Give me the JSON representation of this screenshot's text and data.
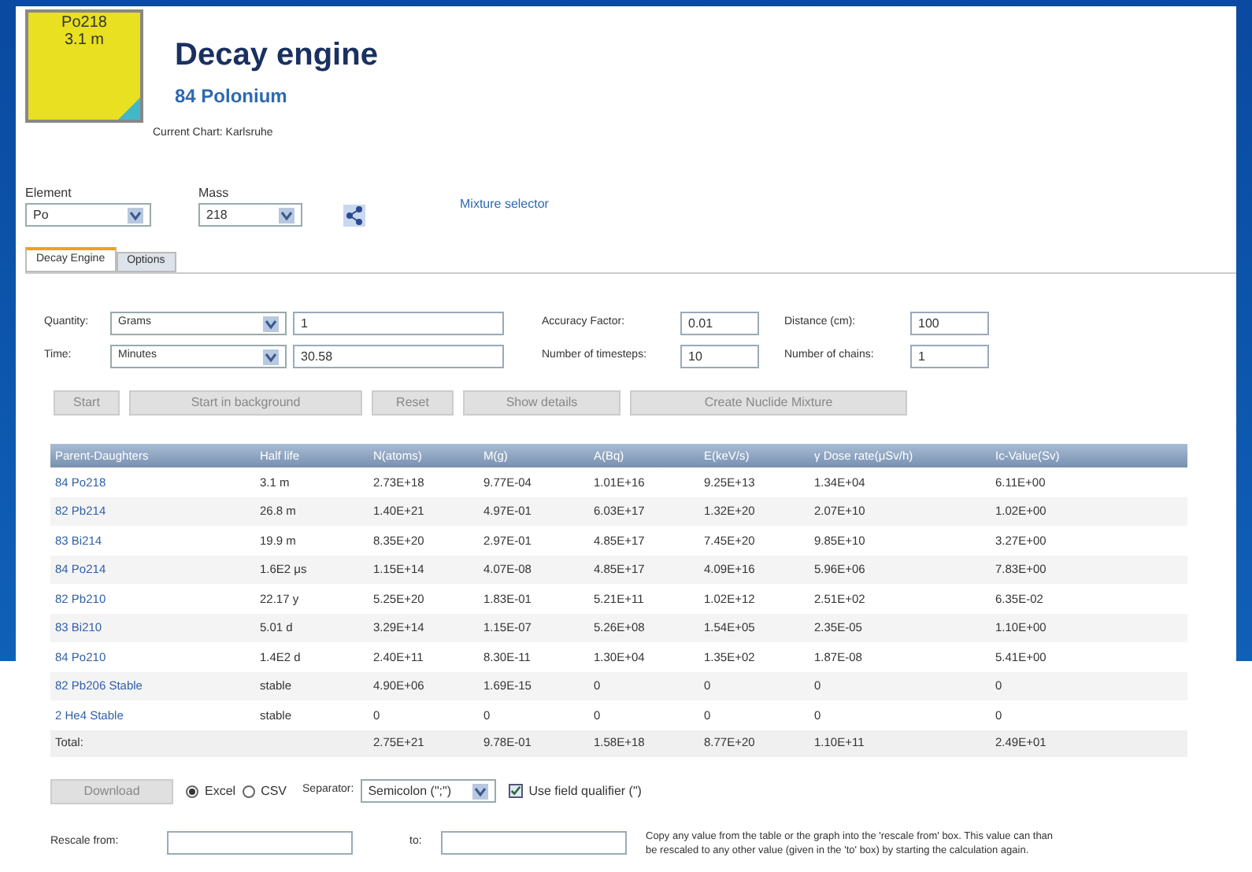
{
  "nuclide_tile": {
    "symbol": "Po218",
    "half_life": "3.1 m"
  },
  "title": "Decay engine",
  "subtitle": "84 Polonium",
  "current_chart": "Current Chart: Karlsruhe",
  "element": {
    "label": "Element",
    "value": "Po"
  },
  "mass": {
    "label": "Mass",
    "value": "218"
  },
  "mixture_link": "Mixture selector",
  "tabs": [
    {
      "label": "Decay Engine",
      "selected": true
    },
    {
      "label": "Options",
      "selected": false
    }
  ],
  "quantity": {
    "label": "Quantity:",
    "unit": "Grams",
    "value": "1"
  },
  "time": {
    "label": "Time:",
    "unit": "Minutes",
    "value": "30.58"
  },
  "params": [
    {
      "label": "Accuracy Factor:",
      "value": "0.01"
    },
    {
      "label": "Distance (cm):",
      "value": "100"
    },
    {
      "label": "Number of timesteps:",
      "value": "10"
    },
    {
      "label": "Number of chains:",
      "value": "1"
    }
  ],
  "actions": [
    "Start",
    "Start in background",
    "Reset",
    "Show details",
    "Create Nuclide Mixture"
  ],
  "table": {
    "columns": [
      "Parent-Daughters",
      "Half life",
      "N(atoms)",
      "M(g)",
      "A(Bq)",
      "E(keV/s)",
      "γ Dose rate(μSv/h)",
      "Ic-Value(Sv)"
    ],
    "rows": [
      [
        "84 Po218",
        "3.1 m",
        "2.73E+18",
        "9.77E-04",
        "1.01E+16",
        "9.25E+13",
        "1.34E+04",
        "6.11E+00"
      ],
      [
        "82 Pb214",
        "26.8 m",
        "1.40E+21",
        "4.97E-01",
        "6.03E+17",
        "1.32E+20",
        "2.07E+10",
        "1.02E+00"
      ],
      [
        "83 Bi214",
        "19.9 m",
        "8.35E+20",
        "2.97E-01",
        "4.85E+17",
        "7.45E+20",
        "9.85E+10",
        "3.27E+00"
      ],
      [
        "84 Po214",
        "1.6E2 μs",
        "1.15E+14",
        "4.07E-08",
        "4.85E+17",
        "4.09E+16",
        "5.96E+06",
        "7.83E+00"
      ],
      [
        "82 Pb210",
        "22.17 y",
        "5.25E+20",
        "1.83E-01",
        "5.21E+11",
        "1.02E+12",
        "2.51E+02",
        "6.35E-02"
      ],
      [
        "83 Bi210",
        "5.01 d",
        "3.29E+14",
        "1.15E-07",
        "5.26E+08",
        "1.54E+05",
        "2.35E-05",
        "1.10E+00"
      ],
      [
        "84 Po210",
        "1.4E2 d",
        "2.40E+11",
        "8.30E-11",
        "1.30E+04",
        "1.35E+02",
        "1.87E-08",
        "5.41E+00"
      ],
      [
        "82 Pb206 Stable",
        "stable",
        "4.90E+06",
        "1.69E-15",
        "0",
        "0",
        "0",
        "0"
      ],
      [
        "2 He4 Stable",
        "stable",
        "0",
        "0",
        "0",
        "0",
        "0",
        "0"
      ]
    ],
    "total": [
      "Total:",
      "2.75E+21",
      "9.78E-01",
      "1.58E+18",
      "8.77E+20",
      "1.10E+11",
      "2.49E+01"
    ]
  },
  "download": "Download",
  "formats": [
    {
      "label": "Excel",
      "selected": true
    },
    {
      "label": "CSV",
      "selected": false
    }
  ],
  "separator": {
    "label": "Separator:",
    "value": "Semicolon (\";\")"
  },
  "qualifier": {
    "label": "Use field qualifier (\")",
    "checked": true
  },
  "rescale_from": {
    "label": "Rescale from:"
  },
  "rescale_to": {
    "label": "to:"
  },
  "rescale_note": "Copy any value from the table or the graph into the 'rescale from' box. This value can than be rescaled to any other value (given in the 'to' box) by starting the calculation again."
}
